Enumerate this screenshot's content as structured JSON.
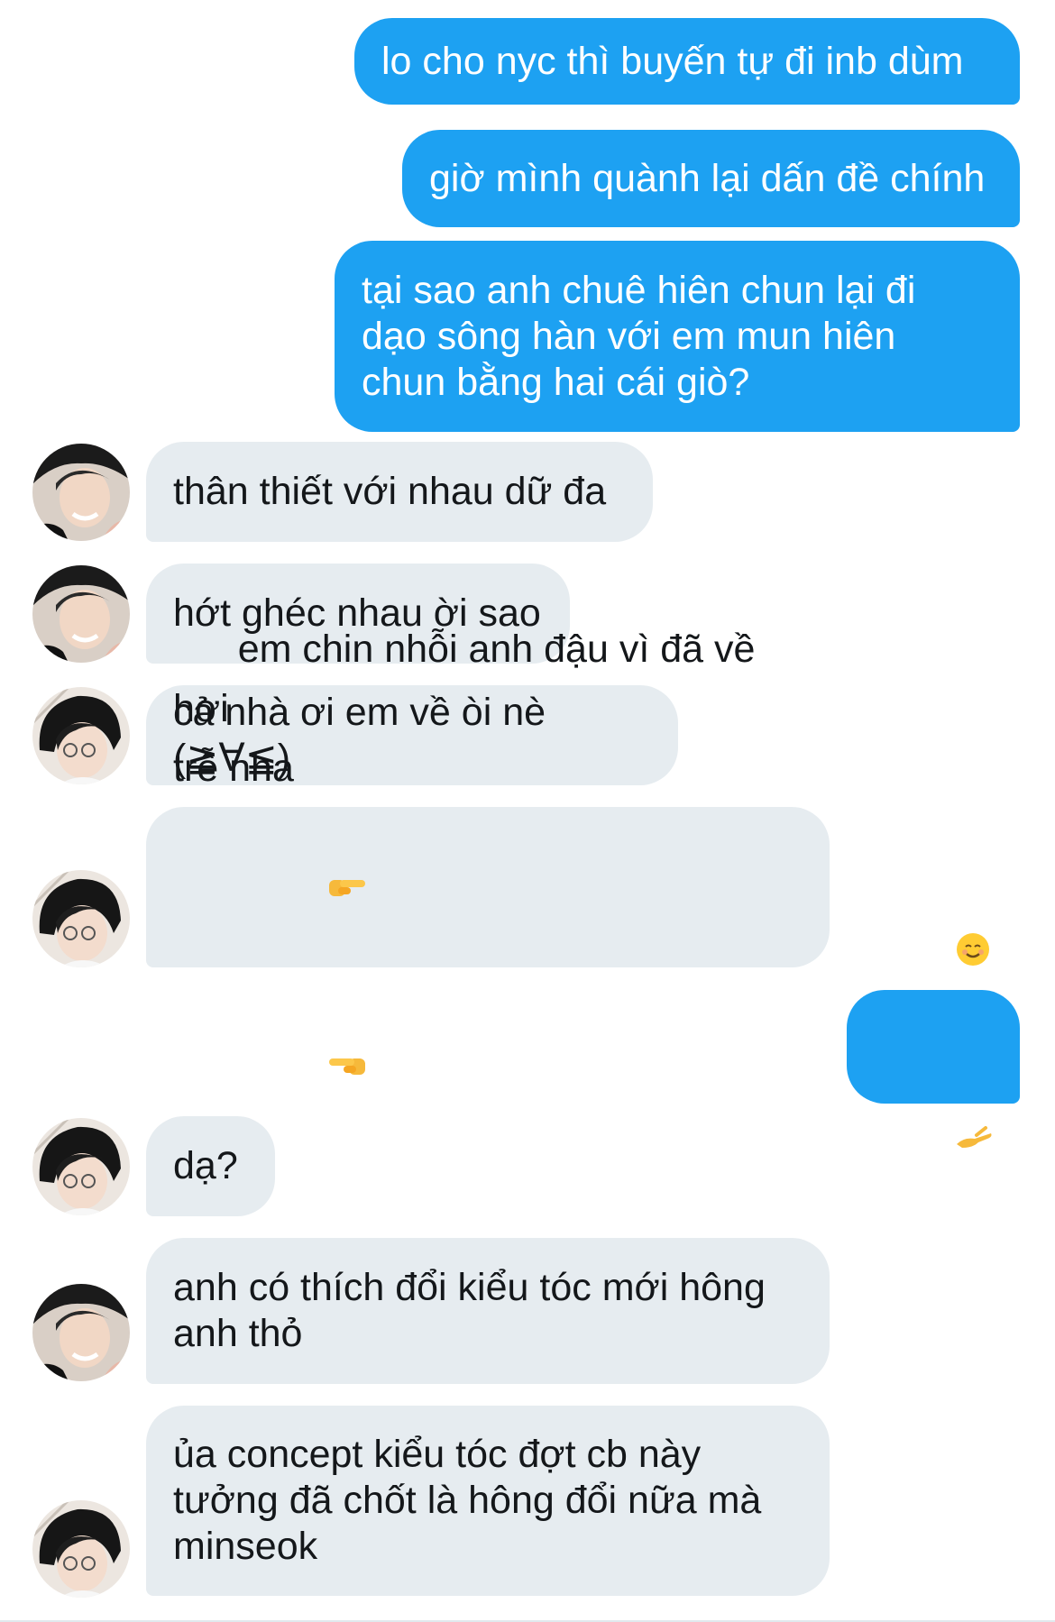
{
  "messages": [
    {
      "sender": "me",
      "text": "lo cho nyc thì buyến tự đi inb dùm"
    },
    {
      "sender": "me",
      "text": "giờ mình quành lại dấn đề chính"
    },
    {
      "sender": "me",
      "text": "tại sao anh chuê hiên chun lại đi\ndạo sông hàn với em mun hiên\nchun bằng hai cái giò?"
    },
    {
      "sender": "user-a",
      "text": "thân thiết với nhau dữ đa"
    },
    {
      "sender": "user-a",
      "text": "hớt ghéc nhau ời sao"
    },
    {
      "sender": "user-b",
      "text": "cả nhà ơi em về òi nè (≧∀≦)"
    },
    {
      "sender": "user-b",
      "text": "em chin nhỗi anh đậu vì đã về hơi\ntrễ nha",
      "emoji": [
        "pointing-right-icon",
        "pointing-left-icon"
      ]
    },
    {
      "sender": "me",
      "text": "?",
      "emoji": [
        "smiling-face-icon",
        "palm-up-hand-icon"
      ]
    },
    {
      "sender": "user-b",
      "text": "dạ?"
    },
    {
      "sender": "user-a",
      "text": "anh có thích đổi kiểu tóc mới hông\nanh thỏ"
    },
    {
      "sender": "user-b",
      "text": "ủa concept kiểu tóc đợt cb này\ntưởng đã chốt là hông đổi nữa mà\nminseok"
    }
  ],
  "colors": {
    "outgoing_bubble": "#1da1f2",
    "incoming_bubble": "#e6ecf0",
    "outgoing_text": "#ffffff",
    "incoming_text": "#14171a"
  }
}
